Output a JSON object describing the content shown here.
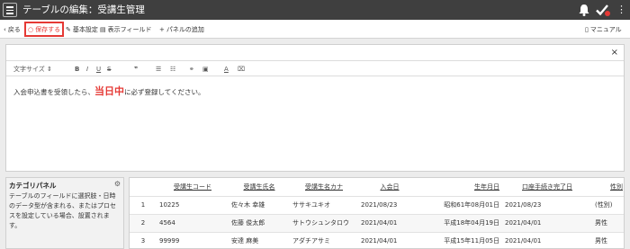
{
  "titlebar": {
    "title": "テーブルの編集：受講生管理",
    "icons": [
      "menu-icon",
      "bell-icon",
      "check-icon",
      "kebab-icon"
    ]
  },
  "toolbar": {
    "back": "戻る",
    "save": "保存する",
    "basic": "基本設定",
    "display_field": "表示フィールド",
    "add_panel": "パネルの追加",
    "manual": "マニュアル"
  },
  "editor": {
    "close": "×",
    "font_size": "文字サイズ",
    "text_before": "入会申込書を受領したら、",
    "text_emph": "当日中",
    "text_after": "に必ず登録してください。"
  },
  "category": {
    "title": "カテゴリパネル",
    "description": "テーブルのフィールドに選択肢・日時のデータ型が含まれる、またはプロセスを設定している場合、設置されます。"
  },
  "table": {
    "headers": [
      "受講生コード",
      "受講生氏名",
      "受講生名カナ",
      "入会日",
      "生年月日",
      "口座手続き完了日",
      "性別"
    ],
    "rows": [
      {
        "num": "1",
        "code": "10225",
        "name": "佐々木 幸雄",
        "kana": "ササキユキオ",
        "join": "2021/08/23",
        "birth": "昭和61年08月01日",
        "done": "2021/08/23",
        "sex": "(性別)"
      },
      {
        "num": "2",
        "code": "4564",
        "name": "佐藤 俊太郎",
        "kana": "サトウシュンタロウ",
        "join": "2021/04/01",
        "birth": "平成18年04月19日",
        "done": "2021/04/01",
        "sex": "男性"
      },
      {
        "num": "3",
        "code": "99999",
        "name": "安達 麻美",
        "kana": "アダチアサミ",
        "join": "2021/04/01",
        "birth": "平成15年11月05日",
        "done": "2021/04/01",
        "sex": "男性"
      }
    ]
  },
  "colors": {
    "accent_red": "#e53935",
    "titlebar": "#3f3f3f"
  }
}
